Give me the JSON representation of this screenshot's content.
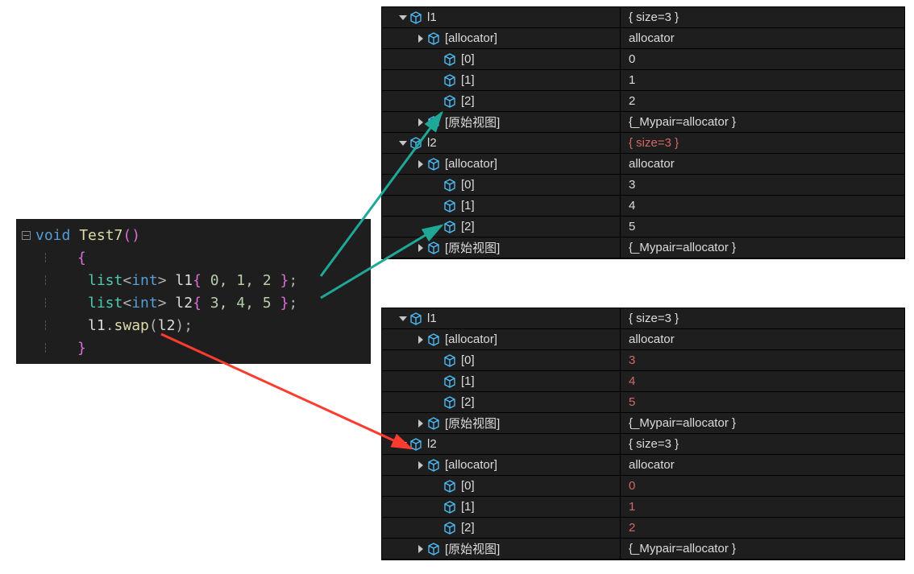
{
  "code": {
    "fn_decl": {
      "kw": "void",
      "name": "Test7",
      "parens": "()"
    },
    "line1": {
      "type": "list",
      "tmpl": "int",
      "var": "l1",
      "vals": "0, 1, 2"
    },
    "line2": {
      "type": "list",
      "tmpl": "int",
      "var": "l2",
      "vals": "3, 4, 5"
    },
    "line3": {
      "obj": "l1",
      "method": "swap",
      "arg": "l2"
    }
  },
  "watch_top": [
    {
      "indent": 1,
      "exp": "down",
      "icon": true,
      "name": "l1",
      "val": "{ size=3 }",
      "red": false
    },
    {
      "indent": 2,
      "exp": "right",
      "icon": true,
      "name": "[allocator]",
      "val": "allocator",
      "red": false
    },
    {
      "indent": 3,
      "exp": "",
      "icon": true,
      "name": "[0]",
      "val": "0",
      "red": false
    },
    {
      "indent": 3,
      "exp": "",
      "icon": true,
      "name": "[1]",
      "val": "1",
      "red": false
    },
    {
      "indent": 3,
      "exp": "",
      "icon": true,
      "name": "[2]",
      "val": "2",
      "red": false
    },
    {
      "indent": 2,
      "exp": "right",
      "icon": true,
      "name": "[原始视图]",
      "val": "{_Mypair=allocator }",
      "red": false
    },
    {
      "indent": 1,
      "exp": "down",
      "icon": true,
      "name": "l2",
      "val": "{ size=3 }",
      "red": true
    },
    {
      "indent": 2,
      "exp": "right",
      "icon": true,
      "name": "[allocator]",
      "val": "allocator",
      "red": false
    },
    {
      "indent": 3,
      "exp": "",
      "icon": true,
      "name": "[0]",
      "val": "3",
      "red": false
    },
    {
      "indent": 3,
      "exp": "",
      "icon": true,
      "name": "[1]",
      "val": "4",
      "red": false
    },
    {
      "indent": 3,
      "exp": "",
      "icon": true,
      "name": "[2]",
      "val": "5",
      "red": false
    },
    {
      "indent": 2,
      "exp": "right",
      "icon": true,
      "name": "[原始视图]",
      "val": "{_Mypair=allocator }",
      "red": false
    }
  ],
  "watch_bot": [
    {
      "indent": 1,
      "exp": "down",
      "icon": true,
      "name": "l1",
      "val": "{ size=3 }",
      "red": false
    },
    {
      "indent": 2,
      "exp": "right",
      "icon": true,
      "name": "[allocator]",
      "val": "allocator",
      "red": false
    },
    {
      "indent": 3,
      "exp": "",
      "icon": true,
      "name": "[0]",
      "val": "3",
      "red": true
    },
    {
      "indent": 3,
      "exp": "",
      "icon": true,
      "name": "[1]",
      "val": "4",
      "red": true
    },
    {
      "indent": 3,
      "exp": "",
      "icon": true,
      "name": "[2]",
      "val": "5",
      "red": true
    },
    {
      "indent": 2,
      "exp": "right",
      "icon": true,
      "name": "[原始视图]",
      "val": "{_Mypair=allocator }",
      "red": false
    },
    {
      "indent": 1,
      "exp": "down",
      "icon": true,
      "name": "l2",
      "val": "{ size=3 }",
      "red": false
    },
    {
      "indent": 2,
      "exp": "right",
      "icon": true,
      "name": "[allocator]",
      "val": "allocator",
      "red": false
    },
    {
      "indent": 3,
      "exp": "",
      "icon": true,
      "name": "[0]",
      "val": "0",
      "red": true
    },
    {
      "indent": 3,
      "exp": "",
      "icon": true,
      "name": "[1]",
      "val": "1",
      "red": true
    },
    {
      "indent": 3,
      "exp": "",
      "icon": true,
      "name": "[2]",
      "val": "2",
      "red": true
    },
    {
      "indent": 2,
      "exp": "right",
      "icon": true,
      "name": "[原始视图]",
      "val": "{_Mypair=allocator }",
      "red": false
    }
  ]
}
